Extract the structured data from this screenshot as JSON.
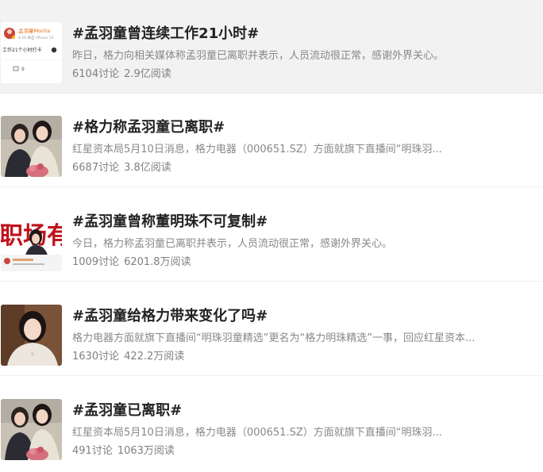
{
  "topics": [
    {
      "title": "#孟羽童曾连续工作21小时#",
      "summary": "昨日，格力向相关媒体称孟羽童已离职并表示，人员流动很正常，感谢外界关心。",
      "discussions": "6104讨论",
      "reads": "2.9亿阅读",
      "thumb": {
        "kind": "weibo-post",
        "username": "孟羽童Morita",
        "meta": "4-16  来自 iPhone 13",
        "body": "工作21个小时打卡",
        "repost_count": "9"
      }
    },
    {
      "title": "#格力称孟羽童已离职#",
      "summary": "红星资本局5月10日消息，格力电器（000651.SZ）方面就旗下直播间“明珠羽...",
      "discussions": "6687讨论",
      "reads": "3.8亿阅读",
      "thumb": {
        "kind": "two-people-photo"
      }
    },
    {
      "title": "#孟羽童曾称董明珠不可复制#",
      "summary": "今日，格力称孟羽童已离职并表示，人员流动很正常，感谢外界关心。",
      "discussions": "1009讨论",
      "reads": "6201.8万阅读",
      "thumb": {
        "kind": "red-banner-photo",
        "banner_text": "职场有"
      }
    },
    {
      "title": "#孟羽童给格力带来变化了吗#",
      "summary": "格力电器方面就旗下直播间“明珠羽童精选”更名为“格力明珠精选”一事，回应红星资本...",
      "discussions": "1630讨论",
      "reads": "422.2万阅读",
      "thumb": {
        "kind": "portrait-photo"
      }
    },
    {
      "title": "#孟羽童已离职#",
      "summary": "红星资本局5月10日消息，格力电器（000651.SZ）方面就旗下直播间“明珠羽...",
      "discussions": "491讨论",
      "reads": "1063万阅读",
      "thumb": {
        "kind": "two-people-photo"
      }
    }
  ],
  "colors": {
    "active_row_bg": "#f2f2f2",
    "title": "#222222",
    "summary": "#888888",
    "stats": "#808080",
    "banner_red": "#c0121d"
  }
}
